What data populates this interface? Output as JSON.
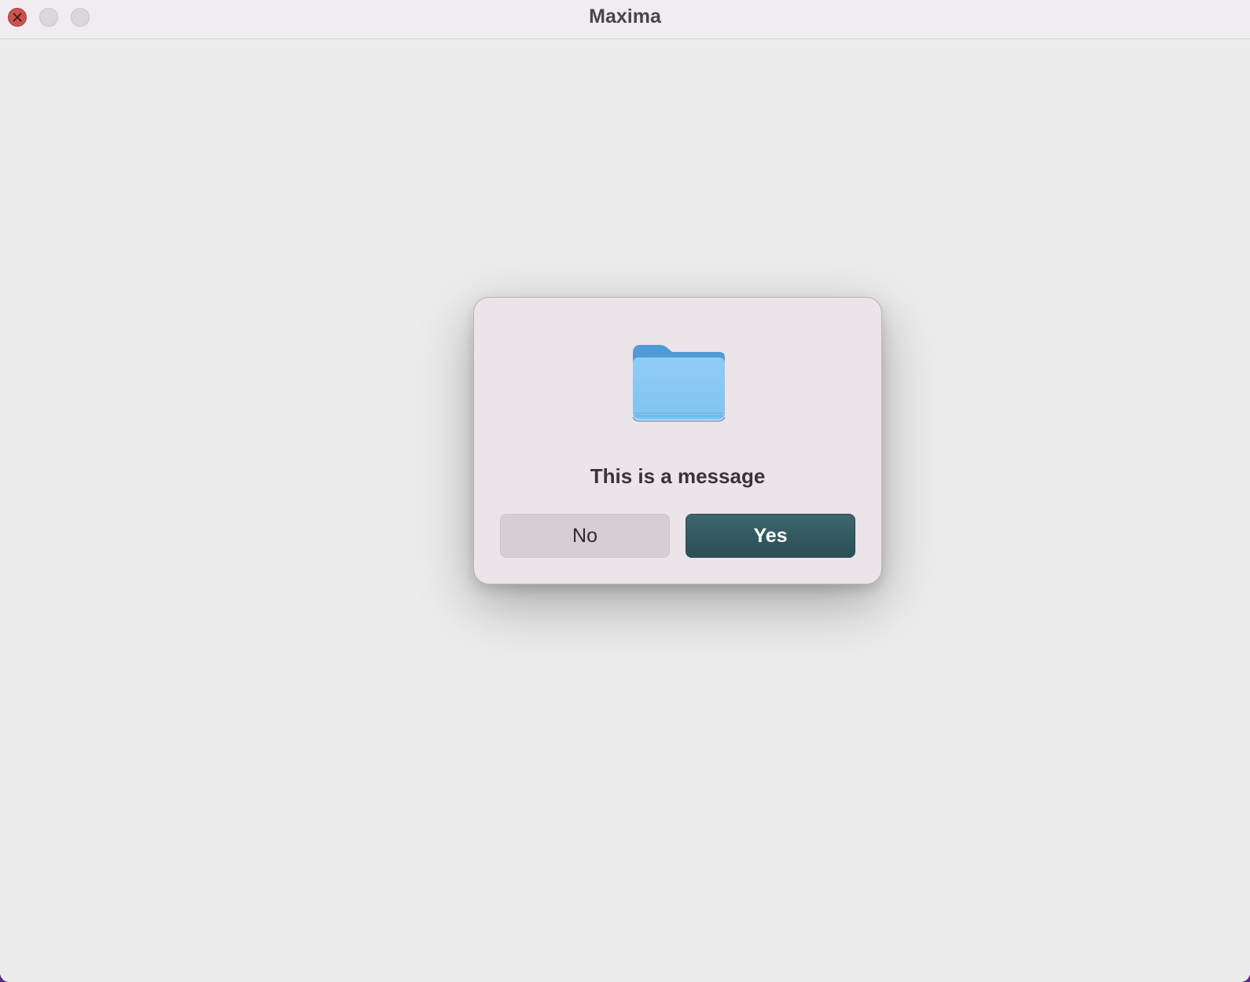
{
  "window": {
    "title": "Maxima"
  },
  "dialog": {
    "icon": "folder-icon",
    "message": "This is a message",
    "buttons": {
      "no_label": "No",
      "yes_label": "Yes"
    }
  },
  "colors": {
    "close_button": "#c8544f",
    "primary_button": "#2f555b",
    "folder_body": "#8ccbf5",
    "folder_tab": "#4e9ad8"
  }
}
